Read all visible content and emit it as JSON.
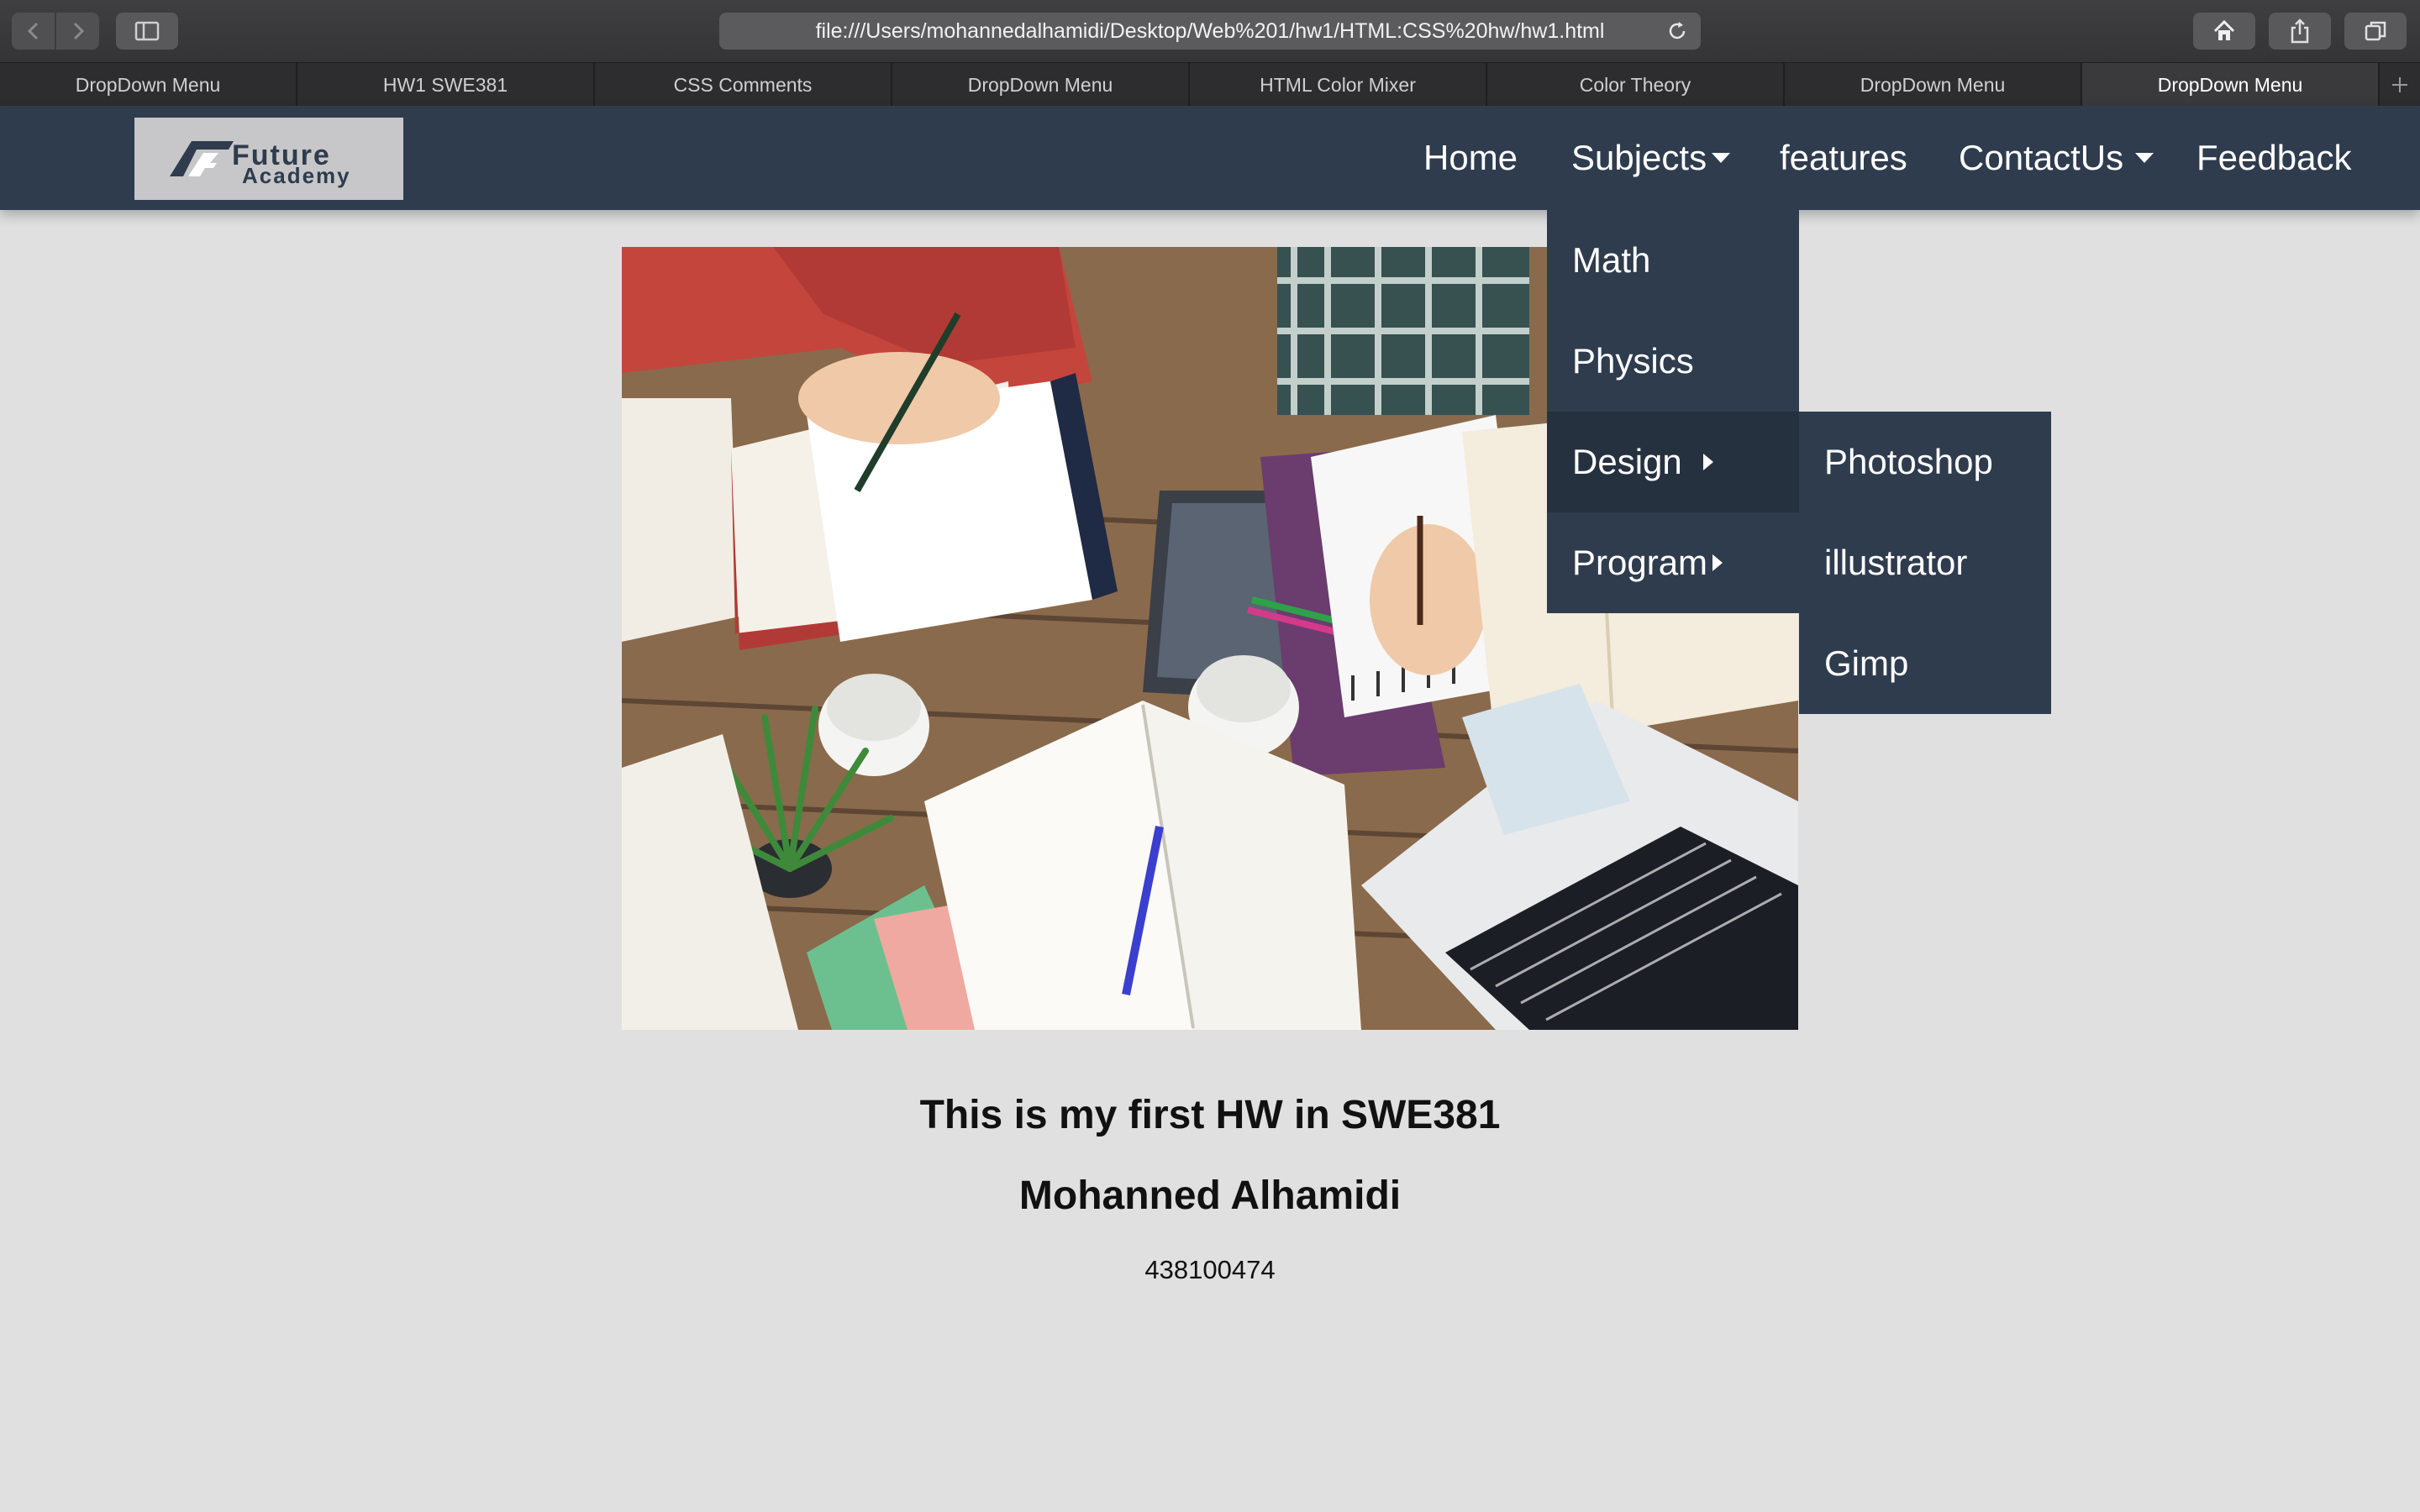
{
  "browser": {
    "url": "file:///Users/mohannedalhamidi/Desktop/Web%201/hw1/HTML:CSS%20hw/hw1.html",
    "tabs": [
      {
        "label": "DropDown Menu"
      },
      {
        "label": "HW1 SWE381"
      },
      {
        "label": "CSS Comments"
      },
      {
        "label": "DropDown Menu"
      },
      {
        "label": "HTML Color Mixer"
      },
      {
        "label": "Color Theory"
      },
      {
        "label": "DropDown Menu"
      },
      {
        "label": "DropDown Menu"
      }
    ],
    "active_tab_index": 7,
    "icons": [
      "back-icon",
      "forward-icon",
      "sidebar-icon",
      "reload-icon",
      "home-icon",
      "share-icon",
      "tabs-overview-icon",
      "new-tab-icon"
    ]
  },
  "logo": {
    "line1": "Future",
    "line2": "Academy"
  },
  "nav": {
    "home": "Home",
    "subjects": "Subjects",
    "features": "features",
    "contact": "ContactUs",
    "feedback": "Feedback"
  },
  "dropdown": {
    "items": [
      "Math",
      "Physics",
      "Design",
      "Program"
    ],
    "hovered": "Design"
  },
  "submenu": {
    "items": [
      "Photoshop",
      "illustrator",
      "Gimp"
    ]
  },
  "content": {
    "heading1": "This is my first HW in SWE381",
    "heading2": "Mohanned Alhamidi",
    "student_id": "438100474"
  },
  "colors": {
    "navbar": "#2f3c4e",
    "page_bg": "#e0e0e0",
    "dropdown_hover": "#263140"
  }
}
